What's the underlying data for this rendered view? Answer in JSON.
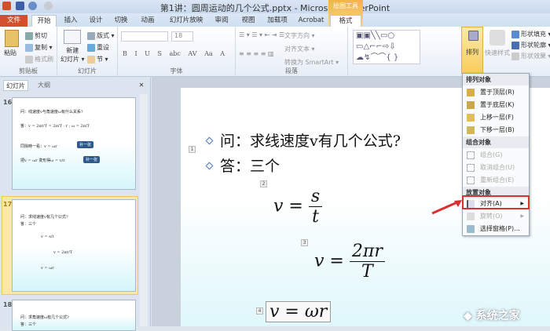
{
  "window": {
    "title": "第1讲：圆周运动的几个公式.pptx - Microsoft PowerPoint",
    "context_tab": "绘图工具"
  },
  "tabs": [
    "文件",
    "开始",
    "插入",
    "设计",
    "切换",
    "动画",
    "幻灯片放映",
    "审阅",
    "视图",
    "加载项",
    "Acrobat",
    "格式"
  ],
  "ribbon": {
    "clipboard": {
      "label": "剪贴板",
      "paste": "粘贴",
      "cut": "剪切",
      "copy": "复制 ▾",
      "format_painter": "格式刷"
    },
    "slides": {
      "label": "幻灯片",
      "new_slide": "新建\n幻灯片 ▾",
      "layout": "版式 ▾",
      "reset": "重设",
      "section": "节 ▾"
    },
    "font": {
      "label": "字体",
      "size": "18",
      "buttons": [
        "B",
        "I",
        "U",
        "S",
        "abc",
        "AV",
        "Aa",
        "A"
      ]
    },
    "paragraph": {
      "label": "段落",
      "text_direction": "文字方向 ▾",
      "align_text": "对齐文本 ▾",
      "smartart": "转换为 SmartArt ▾"
    },
    "drawing": {
      "arrange": "排列",
      "quick_styles": "快速样式",
      "shape_fill": "形状填充 ▾",
      "shape_outline": "形状轮廓 ▾",
      "shape_effects": "形状效果 ▾"
    }
  },
  "pane": {
    "tabs": [
      "幻灯片",
      "大纲"
    ],
    "close": "✕"
  },
  "thumbnails": [
    {
      "num": "16",
      "lines": [
        "问：线速度v与角速度ω有什么关系?",
        "答：v = 2πr/T = 2π/T · r ; ω = 2π/T",
        "同除時一看：v = ωr",
        "把v = ωr 变形得ω = v/r"
      ],
      "callouts": [
        "补一张",
        "补一张"
      ]
    },
    {
      "num": "17",
      "lines": [
        "问：求线速度v有几个公式?",
        "答：三个",
        "v = s/t",
        "v = 2πr/T",
        "v = ωr"
      ]
    },
    {
      "num": "18",
      "lines": [
        "问：求角速度ω有几个公式?",
        "答：三个"
      ]
    }
  ],
  "slide": {
    "question": "问：求线速度v有几个公式?",
    "answer": "答：三个",
    "markers": [
      "1",
      "2",
      "3",
      "4"
    ],
    "formulas": {
      "f1": {
        "lhs": "v =",
        "num": "s",
        "den": "t"
      },
      "f2": {
        "lhs": "v =",
        "num": "2πr",
        "den": "T"
      },
      "f3": "v = ωr"
    }
  },
  "menu": {
    "sections": [
      "排列对象",
      "组合对象",
      "放置对象"
    ],
    "items": [
      "置于顶层(R)",
      "置于底层(K)",
      "上移一层(F)",
      "下移一层(B)",
      "组合(G)",
      "取消组合(U)",
      "重新组合(E)",
      "对齐(A)",
      "旋转(O)",
      "选择窗格(P)..."
    ]
  },
  "watermark": "系统之家"
}
